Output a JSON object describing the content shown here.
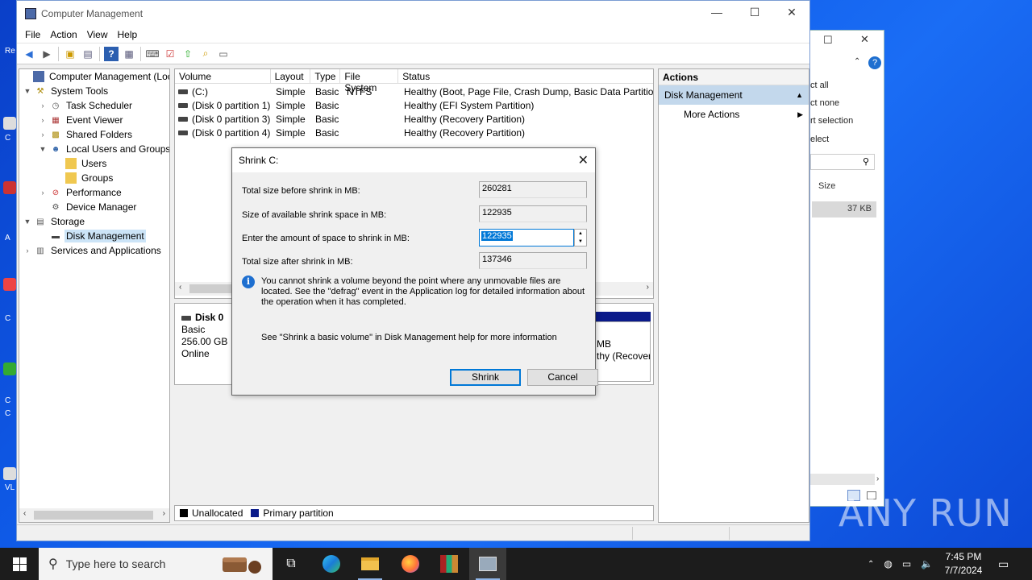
{
  "desktop": {
    "labels": [
      "Re",
      "C",
      "A",
      "C",
      "C",
      "C",
      "VL"
    ]
  },
  "bg_window": {
    "menu": [
      "ct all",
      "ct none",
      "rt selection",
      "elect"
    ],
    "size_header": "Size",
    "size_value": "37 KB"
  },
  "window": {
    "title": "Computer Management",
    "menu": [
      "File",
      "Action",
      "View",
      "Help"
    ]
  },
  "tree": {
    "items": [
      {
        "label": "Computer Management (Local",
        "icon": "computer-icon"
      },
      {
        "label": "System Tools",
        "icon": "tools-icon"
      },
      {
        "label": "Task Scheduler",
        "icon": "clock-icon"
      },
      {
        "label": "Event Viewer",
        "icon": "event-icon"
      },
      {
        "label": "Shared Folders",
        "icon": "shared-folder-icon"
      },
      {
        "label": "Local Users and Groups",
        "icon": "users-icon"
      },
      {
        "label": "Users",
        "icon": "folder-icon"
      },
      {
        "label": "Groups",
        "icon": "folder-icon"
      },
      {
        "label": "Performance",
        "icon": "performance-icon"
      },
      {
        "label": "Device Manager",
        "icon": "device-icon"
      },
      {
        "label": "Storage",
        "icon": "storage-icon"
      },
      {
        "label": "Disk Management",
        "icon": "disk-icon"
      },
      {
        "label": "Services and Applications",
        "icon": "services-icon"
      }
    ]
  },
  "volumes": {
    "headers": [
      "Volume",
      "Layout",
      "Type",
      "File System",
      "Status"
    ],
    "rows": [
      [
        "(C:)",
        "Simple",
        "Basic",
        "NTFS",
        "Healthy (Boot, Page File, Crash Dump, Basic Data Partition)"
      ],
      [
        "(Disk 0 partition 1)",
        "Simple",
        "Basic",
        "",
        "Healthy (EFI System Partition)"
      ],
      [
        "(Disk 0 partition 3)",
        "Simple",
        "Basic",
        "",
        "Healthy (Recovery Partition)"
      ],
      [
        "(Disk 0 partition 4)",
        "Simple",
        "Basic",
        "",
        "Healthy (Recovery Partition)"
      ]
    ]
  },
  "disk": {
    "name": "Disk 0",
    "type": "Basic",
    "size": "256.00 GB",
    "state": "Online",
    "partition_line1": "MB",
    "partition_line2": "thy (Recover"
  },
  "legend": {
    "unallocated": "Unallocated",
    "primary": "Primary partition",
    "unallocated_color": "#000000",
    "primary_color": "#0a1a8a"
  },
  "actions": {
    "header": "Actions",
    "section": "Disk Management",
    "more": "More Actions"
  },
  "dialog": {
    "title": "Shrink C:",
    "total_before_label": "Total size before shrink in MB:",
    "total_before_value": "260281",
    "available_label": "Size of available shrink space in MB:",
    "available_value": "122935",
    "enter_label": "Enter the amount of space to shrink in MB:",
    "enter_value": "122935",
    "total_after_label": "Total size after shrink in MB:",
    "total_after_value": "137346",
    "info": "You cannot shrink a volume beyond the point where any unmovable files are located. See the \"defrag\" event in the Application log for detailed information about the operation when it has completed.",
    "help": "See \"Shrink a basic volume\" in Disk Management help for more information",
    "shrink_btn": "Shrink",
    "cancel_btn": "Cancel"
  },
  "taskbar": {
    "search_placeholder": "Type here to search",
    "time": "7:45 PM",
    "date": "7/7/2024"
  },
  "watermark": "ANY RUN"
}
